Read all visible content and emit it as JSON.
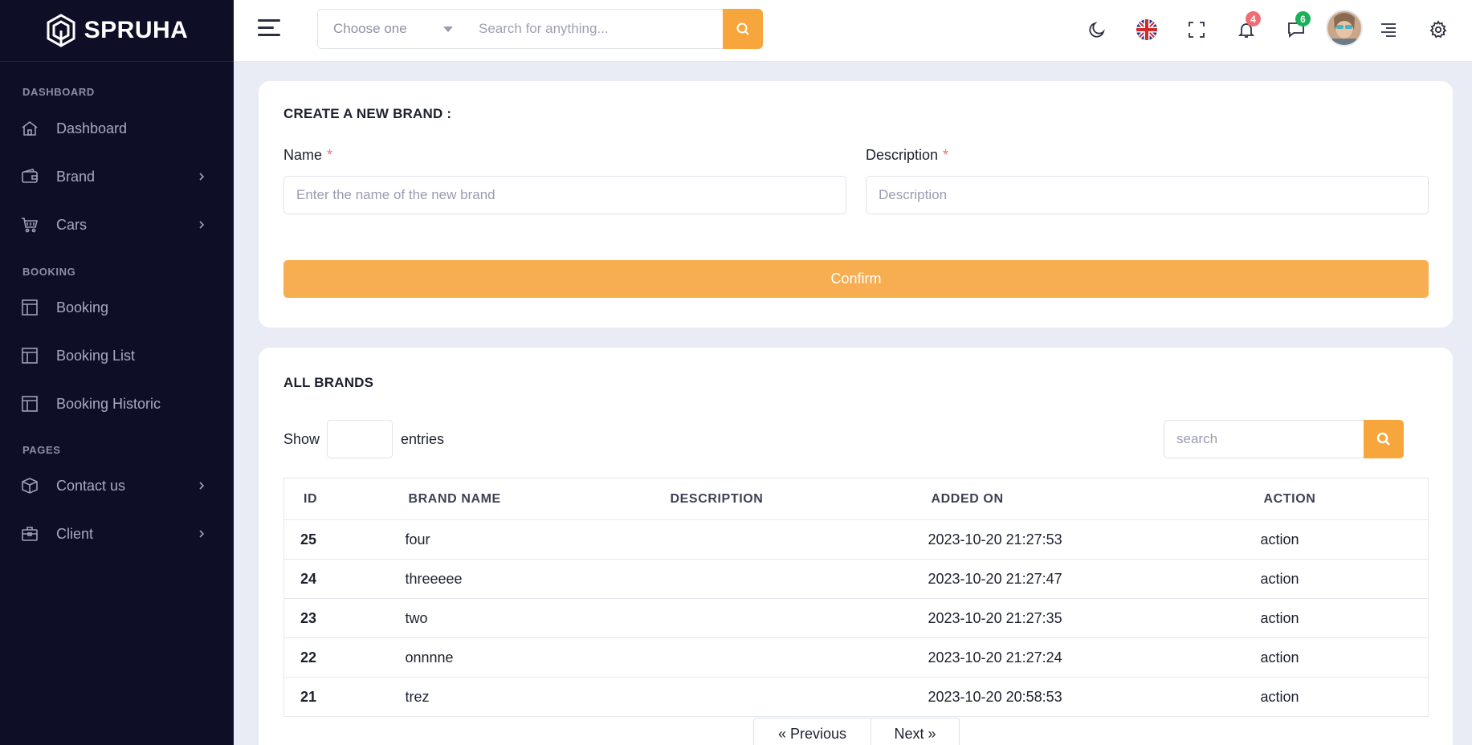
{
  "app": {
    "logo_text": "SPRUHA"
  },
  "sidebar": {
    "sections": [
      {
        "title": "DASHBOARD"
      },
      {
        "title": "BOOKING"
      },
      {
        "title": "PAGES"
      }
    ],
    "items": [
      {
        "label": "Dashboard",
        "icon": "home-icon",
        "has_children": false
      },
      {
        "label": "Brand",
        "icon": "wallet-icon",
        "has_children": true
      },
      {
        "label": "Cars",
        "icon": "cart-icon",
        "has_children": true
      },
      {
        "label": "Booking",
        "icon": "layout-icon",
        "has_children": false
      },
      {
        "label": "Booking List",
        "icon": "layout-icon",
        "has_children": false
      },
      {
        "label": "Booking Historic",
        "icon": "layout-icon",
        "has_children": false
      },
      {
        "label": "Contact us",
        "icon": "box-icon",
        "has_children": true
      },
      {
        "label": "Client",
        "icon": "briefcase-icon",
        "has_children": true
      }
    ]
  },
  "header": {
    "select_placeholder": "Choose one",
    "search_placeholder": "Search for anything...",
    "notifications_count": "4",
    "messages_count": "6",
    "colors": {
      "accent": "#f7a63b",
      "notif_badge": "#f16d75",
      "msg_badge": "#19b159"
    }
  },
  "create_form": {
    "title": "CREATE A NEW BRAND :",
    "name_label": "Name",
    "name_placeholder": "Enter the name of the new brand",
    "description_label": "Description",
    "description_placeholder": "Description",
    "required_mark": "*",
    "confirm_label": "Confirm"
  },
  "brands_table": {
    "title": "ALL BRANDS",
    "show_label": "Show",
    "entries_label": "entries",
    "search_placeholder": "search",
    "columns": [
      "ID",
      "BRAND NAME",
      "DESCRIPTION",
      "ADDED ON",
      "ACTION"
    ],
    "rows": [
      {
        "id": "25",
        "name": "four",
        "description": "",
        "added_on": "2023-10-20 21:27:53",
        "action": "action"
      },
      {
        "id": "24",
        "name": "threeeee",
        "description": "",
        "added_on": "2023-10-20 21:27:47",
        "action": "action"
      },
      {
        "id": "23",
        "name": "two",
        "description": "",
        "added_on": "2023-10-20 21:27:35",
        "action": "action"
      },
      {
        "id": "22",
        "name": "onnnne",
        "description": "",
        "added_on": "2023-10-20 21:27:24",
        "action": "action"
      },
      {
        "id": "21",
        "name": "trez",
        "description": "",
        "added_on": "2023-10-20 20:58:53",
        "action": "action"
      }
    ],
    "prev_label": "« Previous",
    "next_label": "Next »"
  }
}
